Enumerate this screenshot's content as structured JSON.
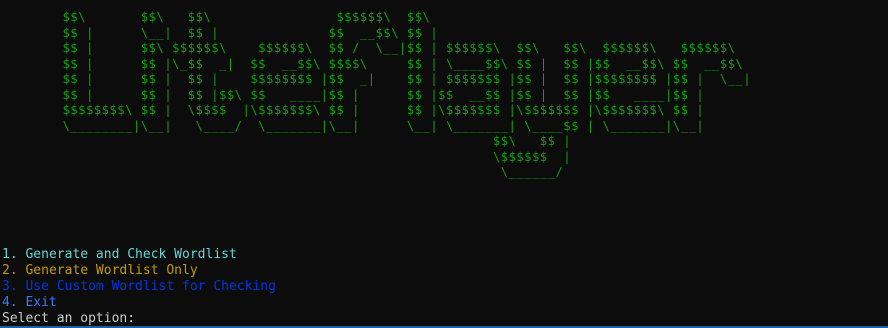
{
  "terminal": {
    "banner_lines": [
      "        $$\\       $$\\   $$\\                $$$$$$\\  $$\\",
      "        $$ |      \\__|  $$ |              $$  __$$\\ $$ |",
      "        $$ |      $$\\ $$$$$$\\    $$$$$$\\  $$ /  \\__|$$ | $$$$$$\\  $$\\   $$\\  $$$$$$\\   $$$$$$\\",
      "        $$ |      $$ |\\_$$  _|  $$  __$$\\ $$$$\\     $$ | \\____$$\\ $$ |  $$ |$$  __$$\\ $$  __$$\\",
      "        $$ |      $$ |  $$ |    $$$$$$$$ |$$  _|    $$ | $$$$$$$ |$$ |  $$ |$$$$$$$$ |$$ |  \\__|",
      "        $$ |      $$ |  $$ |$$\\ $$   ____|$$ |      $$ |$$  __$$ |$$ |  $$ |$$   ____|$$ |",
      "        $$$$$$$$\\ $$ |  \\$$$$  |\\$$$$$$$\\ $$ |      $$ |\\$$$$$$$ |\\$$$$$$$ |\\$$$$$$$\\ $$ |",
      "        \\________|\\__|   \\____/  \\_______|\\__|      \\__| \\_______| \\____$$ | \\_______|\\__|",
      "                                                               $$\\   $$ |",
      "                                                               \\$$$$$$  |",
      "                                                                \\______/"
    ],
    "banner_color": "#13a10e",
    "menu": [
      {
        "label": "1. Generate and Check Wordlist",
        "color": "#61d6d6"
      },
      {
        "label": "2. Generate Wordlist Only",
        "color": "#c19c00"
      },
      {
        "label": "3. Use Custom Wordlist for Checking",
        "color": "#0037da"
      },
      {
        "label": "4. Exit",
        "color": "#3b78ff"
      }
    ],
    "prompt": "Select an option: ",
    "background": "#0c0c0c",
    "text_color": "#cccccc"
  }
}
